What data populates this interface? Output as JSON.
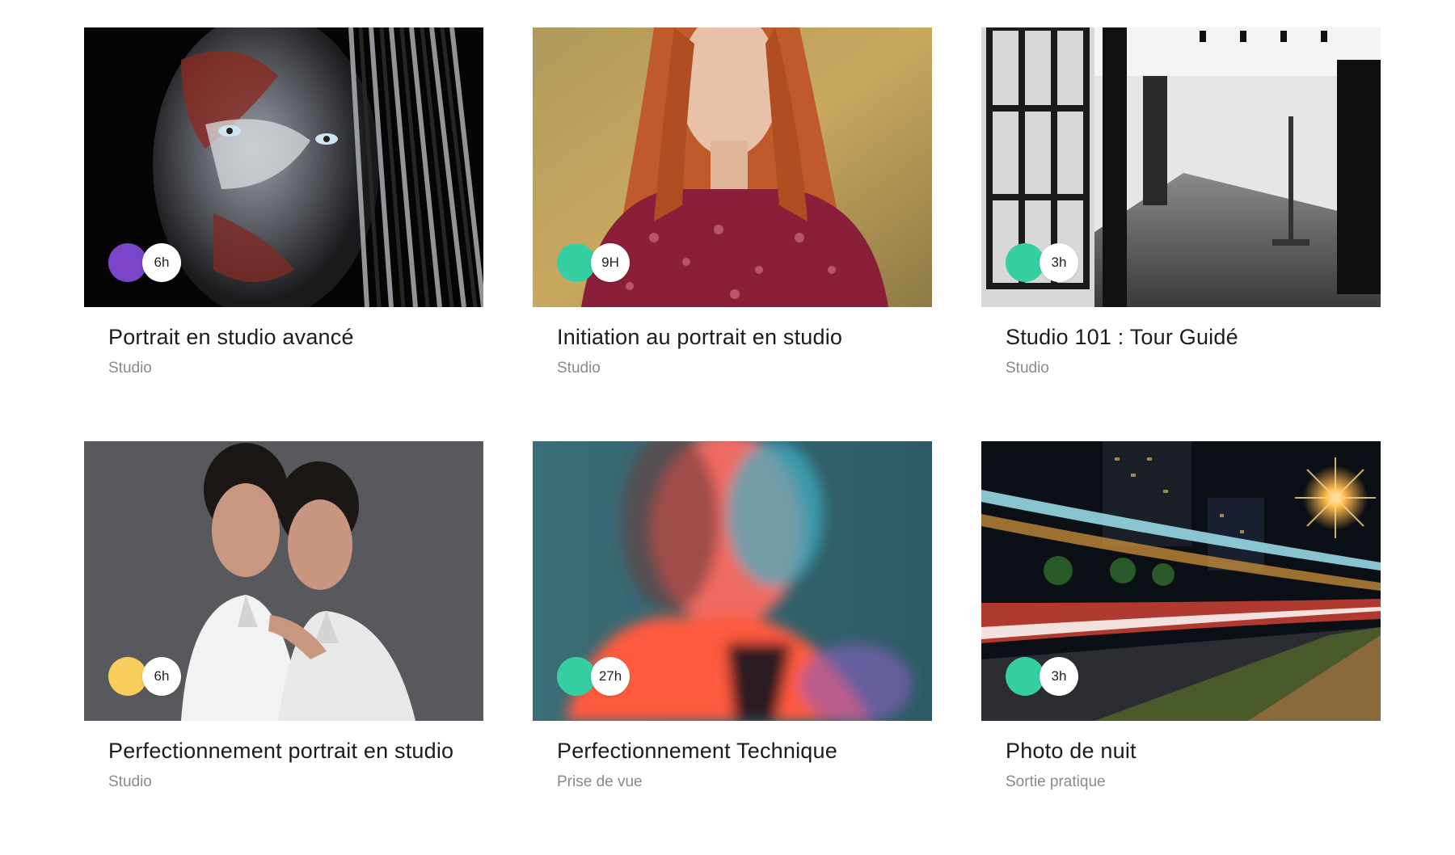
{
  "colors": {
    "purple": "#7a45c8",
    "teal": "#35cfa2",
    "yellow": "#f8cd5e"
  },
  "courses": [
    {
      "title": "Portrait en studio avancé",
      "category": "Studio",
      "duration": "6h",
      "dot_color": "#7a45c8",
      "image": "painted-face-portrait-image"
    },
    {
      "title": "Initiation au portrait en studio",
      "category": "Studio",
      "duration": "9H",
      "dot_color": "#35cfa2",
      "image": "red-haired-woman-portrait-image"
    },
    {
      "title": "Studio 101 : Tour Guidé",
      "category": "Studio",
      "duration": "3h",
      "dot_color": "#35cfa2",
      "image": "studio-interior-image"
    },
    {
      "title": "Perfectionnement portrait en studio",
      "category": "Studio",
      "duration": "6h",
      "dot_color": "#f8cd5e",
      "image": "two-women-portrait-image"
    },
    {
      "title": "Perfectionnement Technique",
      "category": "Prise de vue",
      "duration": "27h",
      "dot_color": "#35cfa2",
      "image": "neon-blurred-portrait-image"
    },
    {
      "title": "Photo de nuit",
      "category": "Sortie pratique",
      "duration": "3h",
      "dot_color": "#35cfa2",
      "image": "night-street-light-trails-image"
    }
  ]
}
